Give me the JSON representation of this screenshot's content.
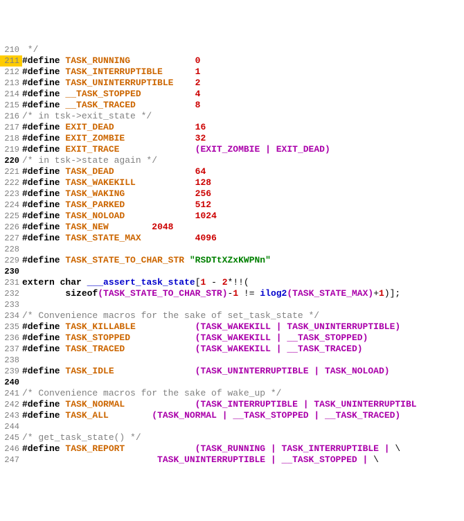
{
  "lines": [
    {
      "num": "210",
      "gutterClass": "",
      "segments": [
        {
          "cls": "comment",
          "text": " */"
        }
      ]
    },
    {
      "num": "211",
      "gutterClass": "gutter-hl",
      "segments": [
        {
          "cls": "kw",
          "text": "#define"
        },
        {
          "cls": "",
          "text": " "
        },
        {
          "cls": "macro",
          "text": "TASK_RUNNING"
        },
        {
          "cls": "",
          "text": "            "
        },
        {
          "cls": "num",
          "text": "0"
        }
      ]
    },
    {
      "num": "212",
      "gutterClass": "",
      "segments": [
        {
          "cls": "kw",
          "text": "#define"
        },
        {
          "cls": "",
          "text": " "
        },
        {
          "cls": "macro",
          "text": "TASK_INTERRUPTIBLE"
        },
        {
          "cls": "",
          "text": "      "
        },
        {
          "cls": "num",
          "text": "1"
        }
      ]
    },
    {
      "num": "213",
      "gutterClass": "",
      "segments": [
        {
          "cls": "kw",
          "text": "#define"
        },
        {
          "cls": "",
          "text": " "
        },
        {
          "cls": "macro",
          "text": "TASK_UNINTERRUPTIBLE"
        },
        {
          "cls": "",
          "text": "    "
        },
        {
          "cls": "num",
          "text": "2"
        }
      ]
    },
    {
      "num": "214",
      "gutterClass": "",
      "segments": [
        {
          "cls": "kw",
          "text": "#define"
        },
        {
          "cls": "",
          "text": " "
        },
        {
          "cls": "macro",
          "text": "__TASK_STOPPED"
        },
        {
          "cls": "",
          "text": "          "
        },
        {
          "cls": "num",
          "text": "4"
        }
      ]
    },
    {
      "num": "215",
      "gutterClass": "",
      "segments": [
        {
          "cls": "kw",
          "text": "#define"
        },
        {
          "cls": "",
          "text": " "
        },
        {
          "cls": "macro",
          "text": "__TASK_TRACED"
        },
        {
          "cls": "",
          "text": "           "
        },
        {
          "cls": "num",
          "text": "8"
        }
      ]
    },
    {
      "num": "216",
      "gutterClass": "",
      "segments": [
        {
          "cls": "comment",
          "text": "/* in tsk->exit_state */"
        }
      ]
    },
    {
      "num": "217",
      "gutterClass": "",
      "segments": [
        {
          "cls": "kw",
          "text": "#define"
        },
        {
          "cls": "",
          "text": " "
        },
        {
          "cls": "macro",
          "text": "EXIT_DEAD"
        },
        {
          "cls": "",
          "text": "               "
        },
        {
          "cls": "num",
          "text": "16"
        }
      ]
    },
    {
      "num": "218",
      "gutterClass": "",
      "segments": [
        {
          "cls": "kw",
          "text": "#define"
        },
        {
          "cls": "",
          "text": " "
        },
        {
          "cls": "macro",
          "text": "EXIT_ZOMBIE"
        },
        {
          "cls": "",
          "text": "             "
        },
        {
          "cls": "num",
          "text": "32"
        }
      ]
    },
    {
      "num": "219",
      "gutterClass": "",
      "segments": [
        {
          "cls": "kw",
          "text": "#define"
        },
        {
          "cls": "",
          "text": " "
        },
        {
          "cls": "macro",
          "text": "EXIT_TRACE"
        },
        {
          "cls": "",
          "text": "              "
        },
        {
          "cls": "paren",
          "text": "("
        },
        {
          "cls": "ident",
          "text": "EXIT_ZOMBIE"
        },
        {
          "cls": "",
          "text": " "
        },
        {
          "cls": "op",
          "text": "|"
        },
        {
          "cls": "",
          "text": " "
        },
        {
          "cls": "ident",
          "text": "EXIT_DEAD"
        },
        {
          "cls": "paren",
          "text": ")"
        }
      ]
    },
    {
      "num": "220",
      "gutterClass": "gutter-bold",
      "segments": [
        {
          "cls": "comment",
          "text": "/* in tsk->state again */"
        }
      ]
    },
    {
      "num": "221",
      "gutterClass": "",
      "segments": [
        {
          "cls": "kw",
          "text": "#define"
        },
        {
          "cls": "",
          "text": " "
        },
        {
          "cls": "macro",
          "text": "TASK_DEAD"
        },
        {
          "cls": "",
          "text": "               "
        },
        {
          "cls": "num",
          "text": "64"
        }
      ]
    },
    {
      "num": "222",
      "gutterClass": "",
      "segments": [
        {
          "cls": "kw",
          "text": "#define"
        },
        {
          "cls": "",
          "text": " "
        },
        {
          "cls": "macro",
          "text": "TASK_WAKEKILL"
        },
        {
          "cls": "",
          "text": "           "
        },
        {
          "cls": "num",
          "text": "128"
        }
      ]
    },
    {
      "num": "223",
      "gutterClass": "",
      "segments": [
        {
          "cls": "kw",
          "text": "#define"
        },
        {
          "cls": "",
          "text": " "
        },
        {
          "cls": "macro",
          "text": "TASK_WAKING"
        },
        {
          "cls": "",
          "text": "             "
        },
        {
          "cls": "num",
          "text": "256"
        }
      ]
    },
    {
      "num": "224",
      "gutterClass": "",
      "segments": [
        {
          "cls": "kw",
          "text": "#define"
        },
        {
          "cls": "",
          "text": " "
        },
        {
          "cls": "macro",
          "text": "TASK_PARKED"
        },
        {
          "cls": "",
          "text": "             "
        },
        {
          "cls": "num",
          "text": "512"
        }
      ]
    },
    {
      "num": "225",
      "gutterClass": "",
      "segments": [
        {
          "cls": "kw",
          "text": "#define"
        },
        {
          "cls": "",
          "text": " "
        },
        {
          "cls": "macro",
          "text": "TASK_NOLOAD"
        },
        {
          "cls": "",
          "text": "             "
        },
        {
          "cls": "num",
          "text": "1024"
        }
      ]
    },
    {
      "num": "226",
      "gutterClass": "",
      "segments": [
        {
          "cls": "kw",
          "text": "#define"
        },
        {
          "cls": "",
          "text": " "
        },
        {
          "cls": "macro",
          "text": "TASK_NEW"
        },
        {
          "cls": "",
          "text": "        "
        },
        {
          "cls": "num",
          "text": "2048"
        }
      ]
    },
    {
      "num": "227",
      "gutterClass": "",
      "segments": [
        {
          "cls": "kw",
          "text": "#define"
        },
        {
          "cls": "",
          "text": " "
        },
        {
          "cls": "macro",
          "text": "TASK_STATE_MAX"
        },
        {
          "cls": "",
          "text": "          "
        },
        {
          "cls": "num",
          "text": "4096"
        }
      ]
    },
    {
      "num": "228",
      "gutterClass": "",
      "segments": []
    },
    {
      "num": "229",
      "gutterClass": "",
      "segments": [
        {
          "cls": "kw",
          "text": "#define"
        },
        {
          "cls": "",
          "text": " "
        },
        {
          "cls": "macro",
          "text": "TASK_STATE_TO_CHAR_STR"
        },
        {
          "cls": "",
          "text": " "
        },
        {
          "cls": "str",
          "text": "\"RSDTtXZxKWPNn\""
        }
      ]
    },
    {
      "num": "230",
      "gutterClass": "gutter-bold",
      "segments": []
    },
    {
      "num": "231",
      "gutterClass": "",
      "segments": [
        {
          "cls": "kw",
          "text": "extern"
        },
        {
          "cls": "",
          "text": " "
        },
        {
          "cls": "kw",
          "text": "char"
        },
        {
          "cls": "",
          "text": " "
        },
        {
          "cls": "type",
          "text": "___assert_task_state"
        },
        {
          "cls": "",
          "text": "["
        },
        {
          "cls": "num",
          "text": "1"
        },
        {
          "cls": "",
          "text": " - "
        },
        {
          "cls": "num",
          "text": "2"
        },
        {
          "cls": "",
          "text": "*!!("
        }
      ]
    },
    {
      "num": "232",
      "gutterClass": "",
      "segments": [
        {
          "cls": "",
          "text": "        "
        },
        {
          "cls": "kw",
          "text": "sizeof"
        },
        {
          "cls": "paren",
          "text": "("
        },
        {
          "cls": "ident",
          "text": "TASK_STATE_TO_CHAR_STR"
        },
        {
          "cls": "paren",
          "text": ")"
        },
        {
          "cls": "",
          "text": "-"
        },
        {
          "cls": "num",
          "text": "1"
        },
        {
          "cls": "",
          "text": " != "
        },
        {
          "cls": "type",
          "text": "ilog2"
        },
        {
          "cls": "paren",
          "text": "("
        },
        {
          "cls": "ident",
          "text": "TASK_STATE_MAX"
        },
        {
          "cls": "paren",
          "text": ")"
        },
        {
          "cls": "",
          "text": "+"
        },
        {
          "cls": "num",
          "text": "1"
        },
        {
          "cls": "",
          "text": ")];"
        }
      ]
    },
    {
      "num": "233",
      "gutterClass": "",
      "segments": []
    },
    {
      "num": "234",
      "gutterClass": "",
      "segments": [
        {
          "cls": "comment",
          "text": "/* Convenience macros for the sake of set_task_state */"
        }
      ]
    },
    {
      "num": "235",
      "gutterClass": "",
      "segments": [
        {
          "cls": "kw",
          "text": "#define"
        },
        {
          "cls": "",
          "text": " "
        },
        {
          "cls": "macro",
          "text": "TASK_KILLABLE"
        },
        {
          "cls": "",
          "text": "           "
        },
        {
          "cls": "paren",
          "text": "("
        },
        {
          "cls": "ident",
          "text": "TASK_WAKEKILL"
        },
        {
          "cls": "",
          "text": " "
        },
        {
          "cls": "op",
          "text": "|"
        },
        {
          "cls": "",
          "text": " "
        },
        {
          "cls": "ident",
          "text": "TASK_UNINTERRUPTIBLE"
        },
        {
          "cls": "paren",
          "text": ")"
        }
      ]
    },
    {
      "num": "236",
      "gutterClass": "",
      "segments": [
        {
          "cls": "kw",
          "text": "#define"
        },
        {
          "cls": "",
          "text": " "
        },
        {
          "cls": "macro",
          "text": "TASK_STOPPED"
        },
        {
          "cls": "",
          "text": "            "
        },
        {
          "cls": "paren",
          "text": "("
        },
        {
          "cls": "ident",
          "text": "TASK_WAKEKILL"
        },
        {
          "cls": "",
          "text": " "
        },
        {
          "cls": "op",
          "text": "|"
        },
        {
          "cls": "",
          "text": " "
        },
        {
          "cls": "ident",
          "text": "__TASK_STOPPED"
        },
        {
          "cls": "paren",
          "text": ")"
        }
      ]
    },
    {
      "num": "237",
      "gutterClass": "",
      "segments": [
        {
          "cls": "kw",
          "text": "#define"
        },
        {
          "cls": "",
          "text": " "
        },
        {
          "cls": "macro",
          "text": "TASK_TRACED"
        },
        {
          "cls": "",
          "text": "             "
        },
        {
          "cls": "paren",
          "text": "("
        },
        {
          "cls": "ident",
          "text": "TASK_WAKEKILL"
        },
        {
          "cls": "",
          "text": " "
        },
        {
          "cls": "op",
          "text": "|"
        },
        {
          "cls": "",
          "text": " "
        },
        {
          "cls": "ident",
          "text": "__TASK_TRACED"
        },
        {
          "cls": "paren",
          "text": ")"
        }
      ]
    },
    {
      "num": "238",
      "gutterClass": "",
      "segments": []
    },
    {
      "num": "239",
      "gutterClass": "",
      "segments": [
        {
          "cls": "kw",
          "text": "#define"
        },
        {
          "cls": "",
          "text": " "
        },
        {
          "cls": "macro",
          "text": "TASK_IDLE"
        },
        {
          "cls": "",
          "text": "               "
        },
        {
          "cls": "paren",
          "text": "("
        },
        {
          "cls": "ident",
          "text": "TASK_UNINTERRUPTIBLE"
        },
        {
          "cls": "",
          "text": " "
        },
        {
          "cls": "op",
          "text": "|"
        },
        {
          "cls": "",
          "text": " "
        },
        {
          "cls": "ident",
          "text": "TASK_NOLOAD"
        },
        {
          "cls": "paren",
          "text": ")"
        }
      ]
    },
    {
      "num": "240",
      "gutterClass": "gutter-bold",
      "segments": []
    },
    {
      "num": "241",
      "gutterClass": "",
      "segments": [
        {
          "cls": "comment",
          "text": "/* Convenience macros for the sake of wake_up */"
        }
      ]
    },
    {
      "num": "242",
      "gutterClass": "",
      "segments": [
        {
          "cls": "kw",
          "text": "#define"
        },
        {
          "cls": "",
          "text": " "
        },
        {
          "cls": "macro",
          "text": "TASK_NORMAL"
        },
        {
          "cls": "",
          "text": "             "
        },
        {
          "cls": "paren",
          "text": "("
        },
        {
          "cls": "ident",
          "text": "TASK_INTERRUPTIBLE"
        },
        {
          "cls": "",
          "text": " "
        },
        {
          "cls": "op",
          "text": "|"
        },
        {
          "cls": "",
          "text": " "
        },
        {
          "cls": "ident",
          "text": "TASK_UNINTERRUPTIBL"
        }
      ]
    },
    {
      "num": "243",
      "gutterClass": "",
      "segments": [
        {
          "cls": "kw",
          "text": "#define"
        },
        {
          "cls": "",
          "text": " "
        },
        {
          "cls": "macro",
          "text": "TASK_ALL"
        },
        {
          "cls": "",
          "text": "        "
        },
        {
          "cls": "paren",
          "text": "("
        },
        {
          "cls": "ident",
          "text": "TASK_NORMAL"
        },
        {
          "cls": "",
          "text": " "
        },
        {
          "cls": "op",
          "text": "|"
        },
        {
          "cls": "",
          "text": " "
        },
        {
          "cls": "ident",
          "text": "__TASK_STOPPED"
        },
        {
          "cls": "",
          "text": " "
        },
        {
          "cls": "op",
          "text": "|"
        },
        {
          "cls": "",
          "text": " "
        },
        {
          "cls": "ident",
          "text": "__TASK_TRACED"
        },
        {
          "cls": "paren",
          "text": ")"
        }
      ]
    },
    {
      "num": "244",
      "gutterClass": "",
      "segments": []
    },
    {
      "num": "245",
      "gutterClass": "",
      "segments": [
        {
          "cls": "comment",
          "text": "/* get_task_state() */"
        }
      ]
    },
    {
      "num": "246",
      "gutterClass": "",
      "segments": [
        {
          "cls": "kw",
          "text": "#define"
        },
        {
          "cls": "",
          "text": " "
        },
        {
          "cls": "macro",
          "text": "TASK_REPORT"
        },
        {
          "cls": "",
          "text": "             "
        },
        {
          "cls": "paren",
          "text": "("
        },
        {
          "cls": "ident",
          "text": "TASK_RUNNING"
        },
        {
          "cls": "",
          "text": " "
        },
        {
          "cls": "op",
          "text": "|"
        },
        {
          "cls": "",
          "text": " "
        },
        {
          "cls": "ident",
          "text": "TASK_INTERRUPTIBLE"
        },
        {
          "cls": "",
          "text": " "
        },
        {
          "cls": "op",
          "text": "|"
        },
        {
          "cls": "",
          "text": " \\"
        }
      ]
    },
    {
      "num": "247",
      "gutterClass": "",
      "segments": [
        {
          "cls": "",
          "text": "                         "
        },
        {
          "cls": "ident",
          "text": "TASK_UNINTERRUPTIBLE"
        },
        {
          "cls": "",
          "text": " "
        },
        {
          "cls": "op",
          "text": "|"
        },
        {
          "cls": "",
          "text": " "
        },
        {
          "cls": "ident",
          "text": "__TASK_STOPPED"
        },
        {
          "cls": "",
          "text": " "
        },
        {
          "cls": "op",
          "text": "|"
        },
        {
          "cls": "",
          "text": " \\"
        }
      ]
    }
  ]
}
